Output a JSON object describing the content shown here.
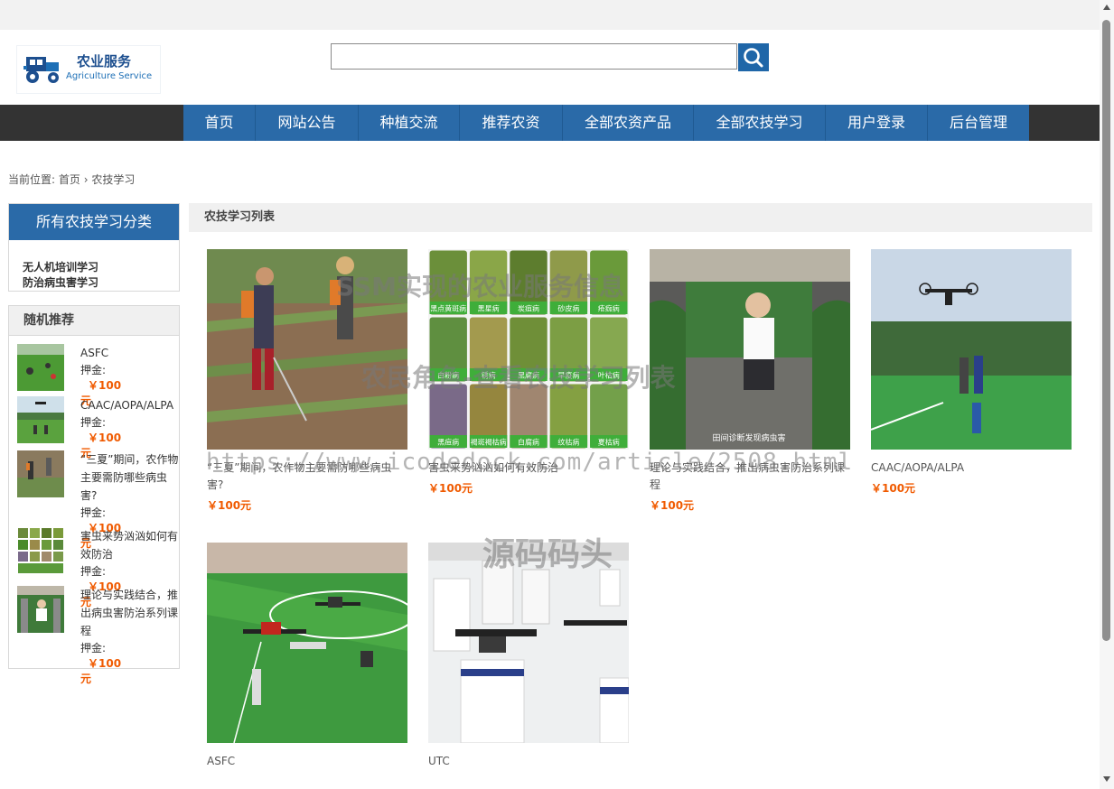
{
  "logo": {
    "cn": "农业服务",
    "en": "Agriculture Service",
    "icon": "tractor-icon"
  },
  "search": {
    "placeholder": "",
    "button_icon": "search-icon"
  },
  "nav": {
    "items": [
      "首页",
      "网站公告",
      "种植交流",
      "推荐农资",
      "全部农资产品",
      "全部农技学习",
      "用户登录",
      "后台管理"
    ]
  },
  "breadcrumb": {
    "prefix": "当前位置:",
    "home": "首页",
    "separator": "›",
    "current": "农技学习"
  },
  "categories": {
    "title": "所有农技学习分类",
    "items": [
      "无人机培训学习",
      "防治病虫害学习"
    ]
  },
  "recommend": {
    "title": "随机推荐",
    "price_label": "押金:",
    "items": [
      {
        "title": "ASFC",
        "price": "￥100元"
      },
      {
        "title": "CAAC/AOPA/ALPA",
        "price": "￥100元"
      },
      {
        "title": "“三夏”期间，农作物主要需防哪些病虫害?",
        "price": "￥100元"
      },
      {
        "title": "害虫来势汹汹如何有效防治",
        "price": "￥100元"
      },
      {
        "title": "理论与实践结合，推出病虫害防治系列课程",
        "price": "￥100元"
      }
    ]
  },
  "list": {
    "title": "农技学习列表",
    "cards": [
      {
        "title": "“三夏”期间，农作物主要需防哪些病虫害?",
        "price": "￥100元"
      },
      {
        "title": "害虫来势汹汹如何有效防治",
        "price": "￥100元"
      },
      {
        "title": "理论与实践结合，推出病虫害防治系列课程",
        "price": "￥100元"
      },
      {
        "title": "CAAC/AOPA/ALPA",
        "price": "￥100元"
      },
      {
        "title": "ASFC",
        "price": ""
      },
      {
        "title": "UTC",
        "price": ""
      }
    ]
  },
  "pest_grid_labels": [
    "黑点黄斑病",
    "黑星病",
    "炭疽病",
    "砂皮病",
    "疮痂病",
    "白粉病",
    "锈病",
    "黑腐病",
    "早疫病",
    "叶枯病",
    "黑痘病",
    "褐斑褐枯病",
    "白腐病",
    "纹枯病",
    "夏枯病"
  ],
  "photo_caption": "田间诊断发现病虫害",
  "watermarks": {
    "line1": "SSM实现的农业服务信息",
    "line2": "农民角色-查看农技学习列表",
    "url": "https://www.icodedock.com/article/2508.html",
    "brand": "源码码头"
  },
  "colors": {
    "nav_blue": "#2a6aa8",
    "price_orange": "#f05a00",
    "dark_bar": "#333333"
  }
}
